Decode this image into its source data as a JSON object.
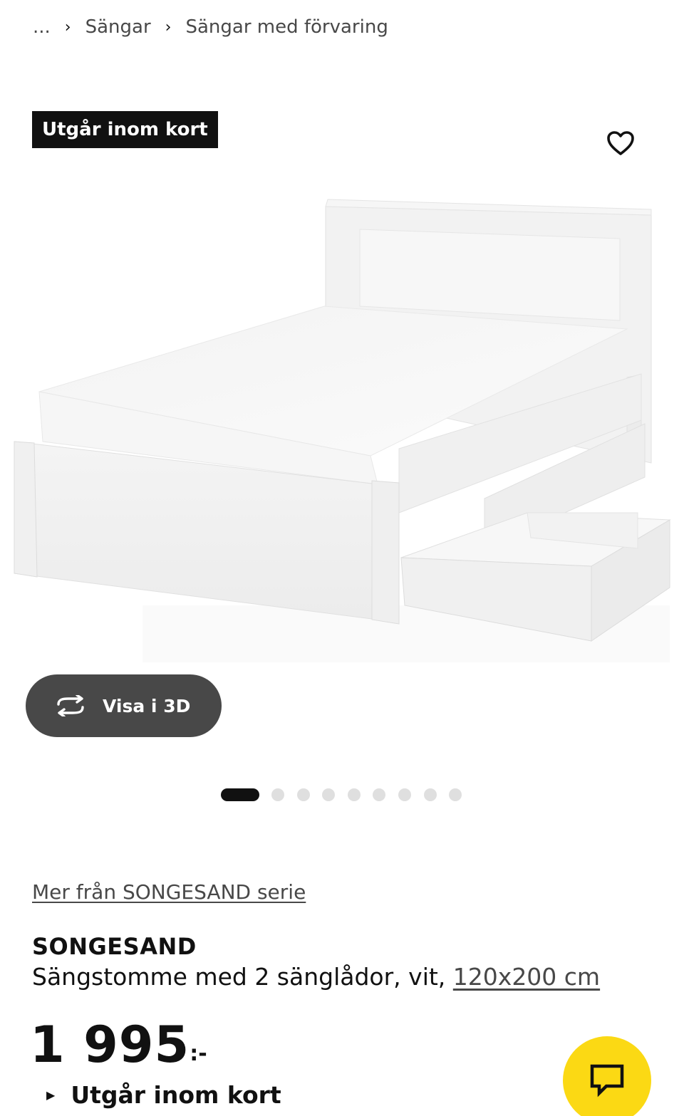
{
  "breadcrumb": {
    "ellipsis": "...",
    "separator": "›",
    "items": [
      "Sängar",
      "Sängar med förvaring"
    ]
  },
  "badge": {
    "label": "Utgår inom kort"
  },
  "favorite": {
    "icon": "heart-icon"
  },
  "gallery": {
    "view3d_label": "Visa i 3D",
    "view3d_icon": "rotate-3d-icon",
    "dot_count": 9,
    "active_index": 0
  },
  "product": {
    "series_link": "Mer från SONGESAND serie",
    "name": "SONGESAND",
    "description": "Sängstomme med 2 sänglådor, vit,",
    "size": "120x200 cm",
    "price": "1 995",
    "price_suffix": ":-",
    "status": "Utgår inom kort"
  },
  "chat": {
    "icon": "chat-icon",
    "color": "#fbd914"
  },
  "colors": {
    "dark": "#111111",
    "secondary": "#484848",
    "button": "#484848",
    "accent": "#fbd914"
  }
}
